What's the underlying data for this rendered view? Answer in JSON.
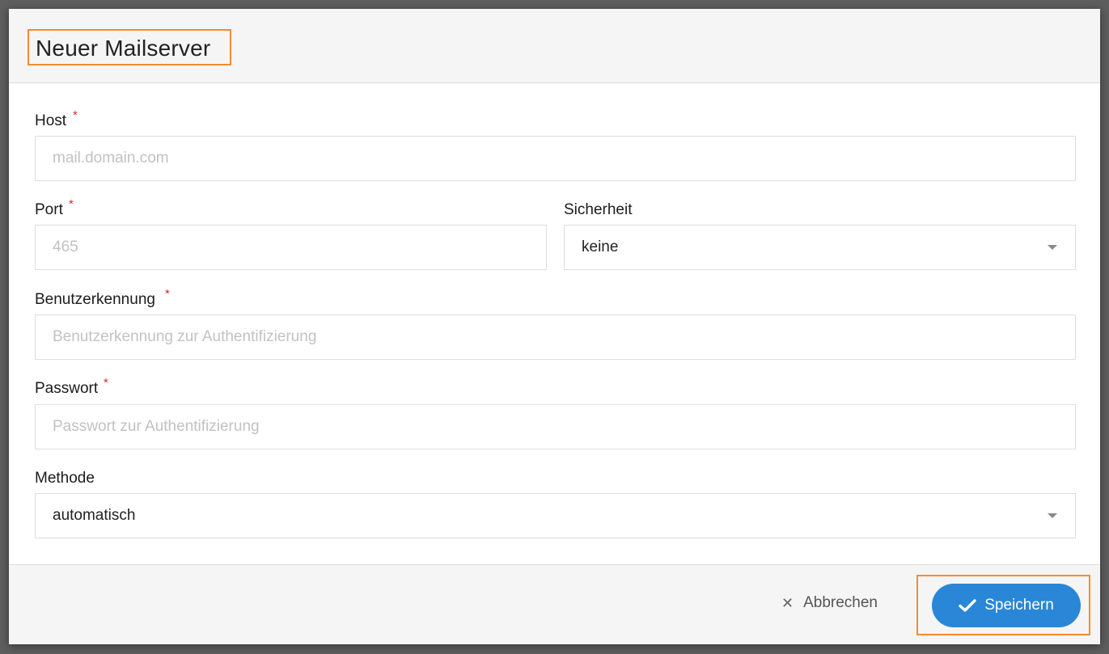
{
  "dialog": {
    "title": "Neuer Mailserver"
  },
  "fields": {
    "host": {
      "label": "Host",
      "required_mark": "*",
      "placeholder": "mail.domain.com",
      "value": ""
    },
    "port": {
      "label": "Port",
      "required_mark": "*",
      "placeholder": "465",
      "value": ""
    },
    "security": {
      "label": "Sicherheit",
      "selected": "keine"
    },
    "username": {
      "label": "Benutzerkennung",
      "required_mark": "*",
      "placeholder": "Benutzerkennung zur Authentifizierung",
      "value": ""
    },
    "password": {
      "label": "Passwort",
      "required_mark": "*",
      "placeholder": "Passwort zur Authentifizierung",
      "value": ""
    },
    "method": {
      "label": "Methode",
      "selected": "automatisch"
    }
  },
  "footer": {
    "cancel_label": "Abbrechen",
    "cancel_icon": "close-icon",
    "save_label": "Speichern",
    "save_icon": "check-icon"
  },
  "colors": {
    "accent": "#2a86d6",
    "required": "#d92b2b",
    "highlight": "#f28c33"
  }
}
